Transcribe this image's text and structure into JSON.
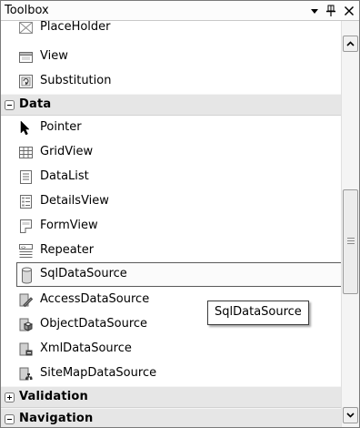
{
  "window": {
    "title": "Toolbox"
  },
  "items": {
    "placeholder": "PlaceHolder",
    "view": "View",
    "substitution": "Substitution",
    "pointer": "Pointer",
    "gridview": "GridView",
    "datalist": "DataList",
    "detailsview": "DetailsView",
    "formview": "FormView",
    "repeater": "Repeater",
    "sqldatasource": "SqlDataSource",
    "accessdatasource": "AccessDataSource",
    "objectdatasource": "ObjectDataSource",
    "xmldatasource": "XmlDataSource",
    "sitemapdatasource": "SiteMapDataSource"
  },
  "categories": {
    "data": "Data",
    "validation": "Validation",
    "navigation": "Navigation"
  },
  "tooltip": {
    "text": "SqlDataSource"
  }
}
